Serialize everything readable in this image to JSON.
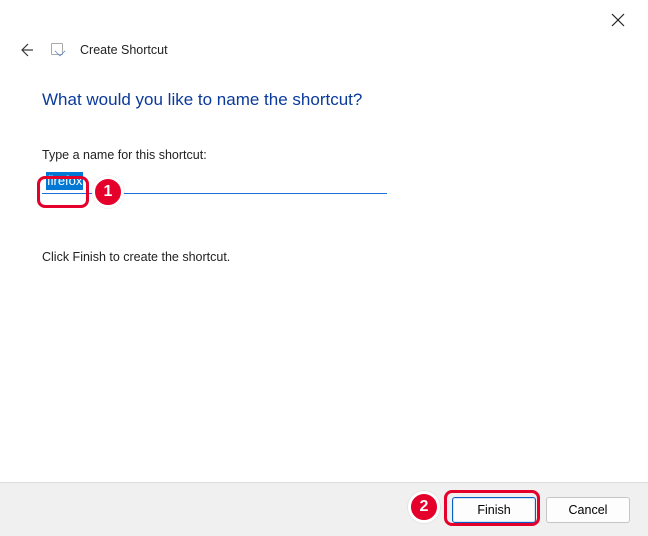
{
  "window": {
    "close_tooltip": "Close"
  },
  "header": {
    "back_tooltip": "Back",
    "title": "Create Shortcut"
  },
  "content": {
    "heading": "What would you like to name the shortcut?",
    "label": "Type a name for this shortcut:",
    "input_value": "firefox",
    "hint": "Click Finish to create the shortcut."
  },
  "buttons": {
    "finish": "Finish",
    "cancel": "Cancel"
  },
  "annotations": {
    "step1": "1",
    "step2": "2"
  }
}
